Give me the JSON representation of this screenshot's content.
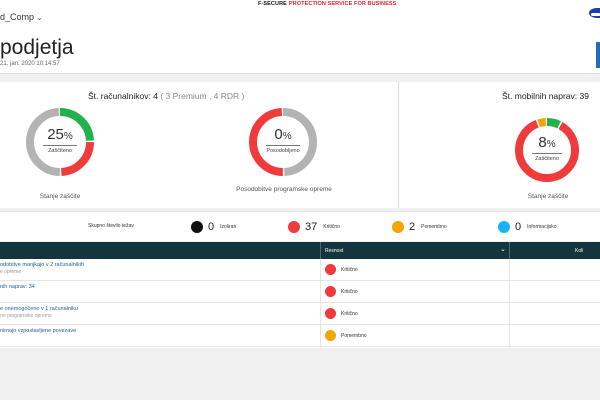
{
  "topbar": {
    "company": "d_Comp",
    "brand_main": "F-SECURE",
    "brand_sub": "PROTECTION SERVICE FOR BUSINESS"
  },
  "header": {
    "title": "podjetja",
    "date": "21. jan. 2020 10:14:57"
  },
  "computers": {
    "title": "Št. računalnikov: 4",
    "title_detail": "( 3 Premium , 4 RDR )",
    "protection": {
      "percent": "25",
      "sign": "%",
      "label": "Zaščiteno",
      "caption": "Stanje zaščite",
      "fraction": 0.25
    },
    "updates": {
      "percent": "0",
      "sign": "%",
      "label": "Posodobljeno",
      "caption": "Posodobitve programske opreme",
      "fraction": 0
    }
  },
  "mobile": {
    "title": "Št. mobilnih naprav: 39",
    "protection": {
      "percent": "8",
      "sign": "%",
      "label": "Zaščiteno",
      "caption": "Stanje zaščite",
      "fraction": 0.08
    }
  },
  "severity": {
    "label": "Skupno število težav",
    "items": [
      {
        "count": "0",
        "label": "Izoliran",
        "color": "#111111"
      },
      {
        "count": "37",
        "label": "Kritično",
        "color": "#ef3b3b"
      },
      {
        "count": "2",
        "label": "Pomembno",
        "color": "#f5a400"
      },
      {
        "count": "0",
        "label": "Informacijsko",
        "color": "#1ab5f0"
      }
    ]
  },
  "table": {
    "header_severity": "Resnost",
    "header_right": "Koli",
    "rows": [
      {
        "main": "odobitve manjkajo v 2 računalnikih",
        "sub": "e opreme",
        "severity": "Kritično",
        "color": "#ef3b3b"
      },
      {
        "main": "nih naprav: 34",
        "sub": "",
        "severity": "Kritično",
        "color": "#ef3b3b"
      },
      {
        "main": "e onemogočeno v 1 računalniku",
        "sub": "no programsko opremo",
        "severity": "Kritično",
        "color": "#ef3b3b"
      },
      {
        "main": "nimajo vzpostavljene povezave",
        "sub": "",
        "severity": "Pomembno",
        "color": "#f5a400"
      }
    ]
  },
  "colors": {
    "protected": "#22b14c",
    "unprotected": "#ef3b3b",
    "neutral": "#b3b3b3",
    "warning": "#f5a400"
  }
}
